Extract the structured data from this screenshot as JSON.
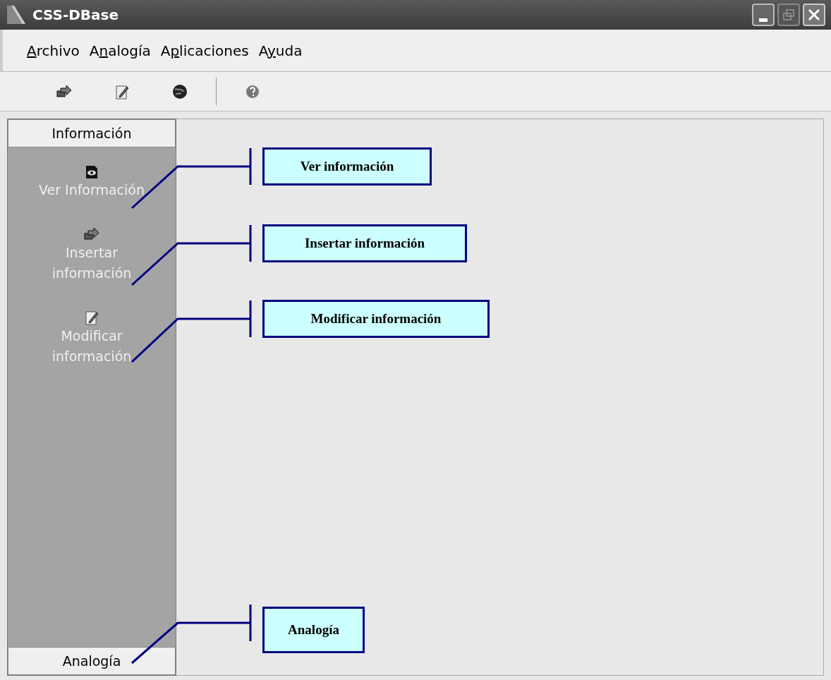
{
  "window": {
    "title": "CSS-DBase"
  },
  "menu": [
    {
      "key": "A",
      "after": "rchivo"
    },
    {
      "before": "A",
      "key": "n",
      "after": "alogía"
    },
    {
      "before": "A",
      "key": "p",
      "after": "licaciones"
    },
    {
      "before": "A",
      "key": "y",
      "after": "uda"
    }
  ],
  "toolbar": [
    {
      "kind": "insert"
    },
    {
      "kind": "edit"
    },
    {
      "kind": "globe"
    },
    {
      "kind": "separator"
    },
    {
      "kind": "help"
    }
  ],
  "sidebar": {
    "header": "Información",
    "items": [
      {
        "kind": "view",
        "label": "Ver Información"
      },
      {
        "kind": "insert",
        "label": "Insertar información"
      },
      {
        "kind": "edit",
        "label": "Modificar información"
      }
    ],
    "footer": "Analogía"
  },
  "callouts": [
    "Ver información",
    "Insertar información",
    "Modificar información",
    "Analogía"
  ]
}
